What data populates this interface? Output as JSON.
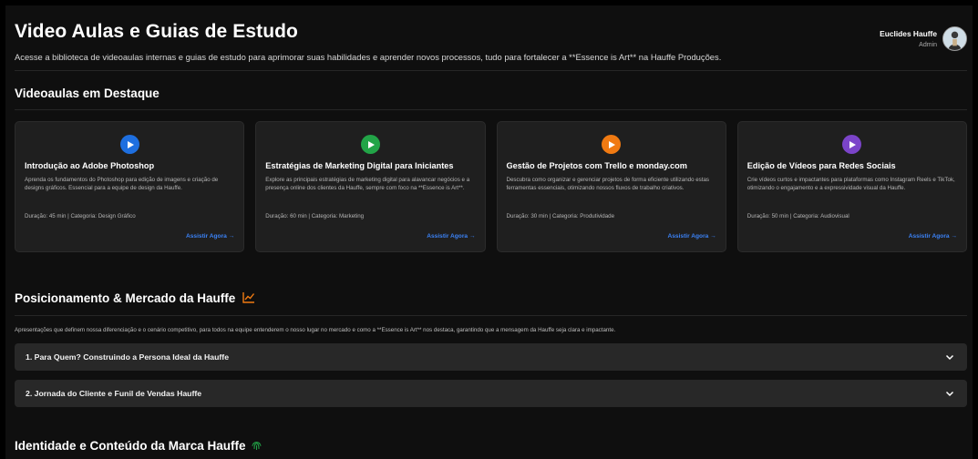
{
  "header": {
    "title": "Video Aulas e Guias de Estudo",
    "subtitle": "Acesse a biblioteca de videoaulas internas e guias de estudo para aprimorar suas habilidades e aprender novos processos, tudo para fortalecer a **Essence is Art** na Hauffe Produções.",
    "user_name": "Euclides Hauffe",
    "user_role": "Admin"
  },
  "featured": {
    "title": "Videoaulas em Destaque",
    "cards": [
      {
        "icon": "play-icon",
        "color": "#1e6fe0",
        "title": "Introdução ao Adobe Photoshop",
        "description": "Aprenda os fundamentos do Photoshop para edição de imagens e criação de designs gráficos. Essencial para a equipe de design da Hauffe.",
        "meta": "Duração: 45 min | Categoria: Design Gráfico",
        "link": "Assistir Agora →"
      },
      {
        "icon": "play-icon",
        "color": "#22a447",
        "title": "Estratégias de Marketing Digital para Iniciantes",
        "description": "Explore as principais estratégias de marketing digital para alavancar negócios e a presença online dos clientes da Hauffe, sempre com foco na **Essence is Art**.",
        "meta": "Duração: 60 min | Categoria: Marketing",
        "link": "Assistir Agora →"
      },
      {
        "icon": "play-icon",
        "color": "#f07a12",
        "title": "Gestão de Projetos com Trello e monday.com",
        "description": "Descubra como organizar e gerenciar projetos de forma eficiente utilizando estas ferramentas essenciais, otimizando nossos fluxos de trabalho criativos.",
        "meta": "Duração: 30 min | Categoria: Produtividade",
        "link": "Assistir Agora →"
      },
      {
        "icon": "play-icon",
        "color": "#7b44c9",
        "title": "Edição de Vídeos para Redes Sociais",
        "description": "Crie vídeos curtos e impactantes para plataformas como Instagram Reels e TikTok, otimizando o engajamento e a expressividade visual da Hauffe.",
        "meta": "Duração: 50 min | Categoria: Audiovisual",
        "link": "Assistir Agora →"
      }
    ]
  },
  "positioning": {
    "title": "Posicionamento & Mercado da Hauffe",
    "icon": "chart-increasing-icon",
    "description": "Apresentações que definem nossa diferenciação e o cenário competitivo, para todos na equipe entenderem o nosso lugar no mercado e como a **Essence is Art** nos destaca, garantindo que a mensagem da Hauffe seja clara e impactante.",
    "items": [
      {
        "label": "1. Para Quem? Construindo a Persona Ideal da Hauffe"
      },
      {
        "label": "2. Jornada do Cliente e Funil de Vendas Hauffe"
      }
    ]
  },
  "identity": {
    "title": "Identidade e Conteúdo da Marca Hauffe",
    "icon": "fingerprint-icon"
  },
  "colors": {
    "background": "#0f0f0f",
    "card": "#1f1f1f",
    "link": "#3b82f6",
    "accent_orange": "#f07a12",
    "accent_green": "#22a447"
  }
}
